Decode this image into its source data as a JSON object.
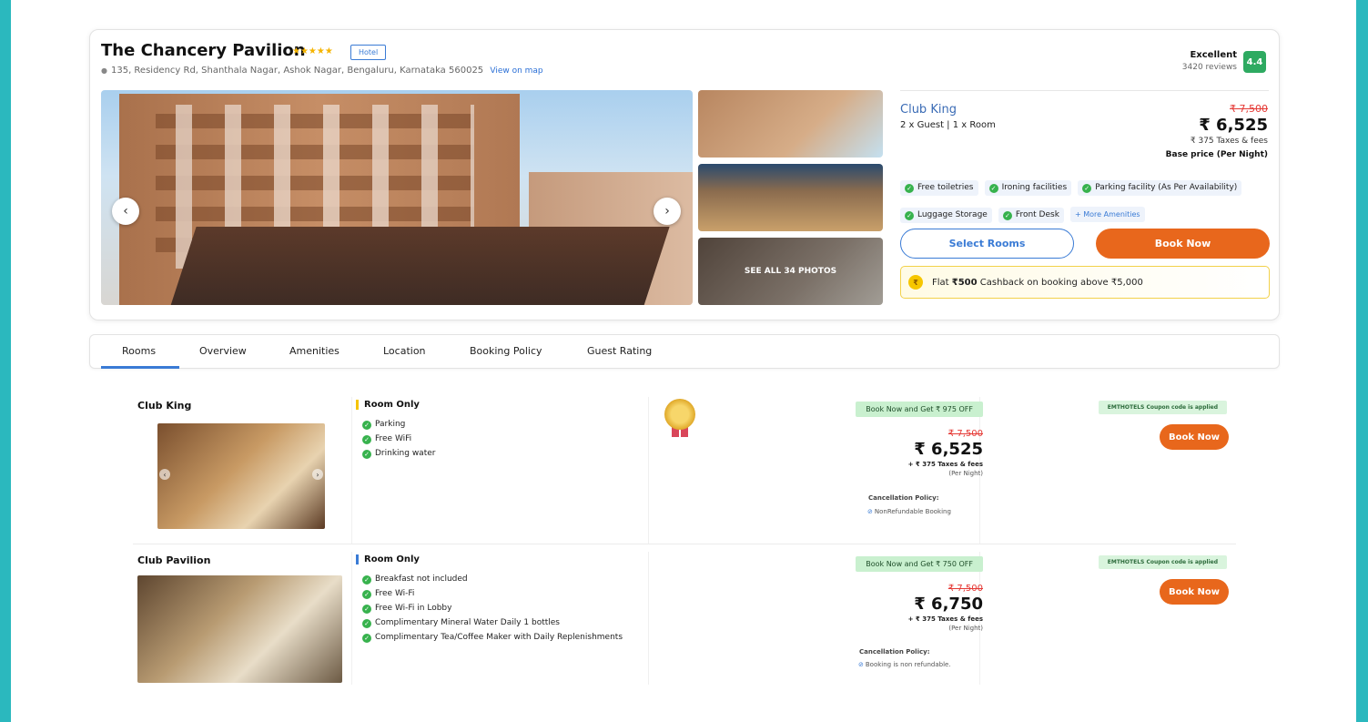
{
  "hotel": {
    "name": "The Chancery Pavilion",
    "stars": "★★★★★",
    "type_badge": "Hotel",
    "address": "135, Residency Rd, Shanthala Nagar, Ashok Nagar, Bengaluru, Karnataka 560025",
    "view_map": "View on map",
    "rating_label": "Excellent",
    "reviews": "3420 reviews",
    "score": "4.4"
  },
  "gallery": {
    "prev_icon": "‹",
    "next_icon": "›",
    "see_all": "SEE ALL 34 PHOTOS"
  },
  "summary": {
    "room_type": "Club King",
    "guests": "2 x Guest | 1 x Room",
    "old_price": "₹ 7,500",
    "price": "₹ 6,525",
    "taxes": "₹ 375 Taxes & fees",
    "base_price": "Base price (Per Night)",
    "amenities": [
      "Free toiletries",
      "Ironing facilities",
      "Parking facility (As Per Availability)",
      "Luggage Storage",
      "Front Desk"
    ],
    "more_amenities": "+ More Amenities",
    "select_rooms": "Select Rooms",
    "book_now": "Book Now",
    "cashback_prefix": "Flat ",
    "cashback_amount": "₹500",
    "cashback_suffix": " Cashback on booking above ₹5,000",
    "coin_symbol": "₹"
  },
  "tabs": [
    "Rooms",
    "Overview",
    "Amenities",
    "Location",
    "Booking Policy",
    "Guest Rating"
  ],
  "rooms": [
    {
      "name": "Club King",
      "plan": "Room Only",
      "features": [
        "Parking",
        "Free WiFi",
        "Drinking water"
      ],
      "offer": "Book Now and Get ₹ 975 OFF",
      "old_price": "₹ 7,500",
      "price": "₹ 6,525",
      "taxes": "+ ₹ 375 Taxes & fees",
      "per_night": "(Per Night)",
      "cancel_title": "Cancellation Policy:",
      "cancel_text": "NonRefundable Booking",
      "coupon": "EMTHOTELS Coupon code is applied",
      "book": "Book Now"
    },
    {
      "name": "Club Pavilion",
      "plan": "Room Only",
      "features": [
        "Breakfast not included",
        "Free Wi-Fi",
        "Free Wi-Fi in Lobby",
        "Complimentary Mineral Water Daily 1 bottles",
        "Complimentary Tea/Coffee Maker with Daily Replenishments"
      ],
      "offer": "Book Now and Get ₹ 750 OFF",
      "old_price": "₹ 7,500",
      "price": "₹ 6,750",
      "taxes": "+ ₹ 375 Taxes & fees",
      "per_night": "(Per Night)",
      "cancel_title": "Cancellation Policy:",
      "cancel_text": "Booking is non refundable.",
      "coupon": "EMTHOTELS Coupon code is applied",
      "book": "Book Now"
    }
  ],
  "colors": {
    "accent_orange": "#e8671c",
    "link_blue": "#3a7bd5",
    "rating_green": "#2eaa61",
    "page_frame": "#2bb8be"
  }
}
